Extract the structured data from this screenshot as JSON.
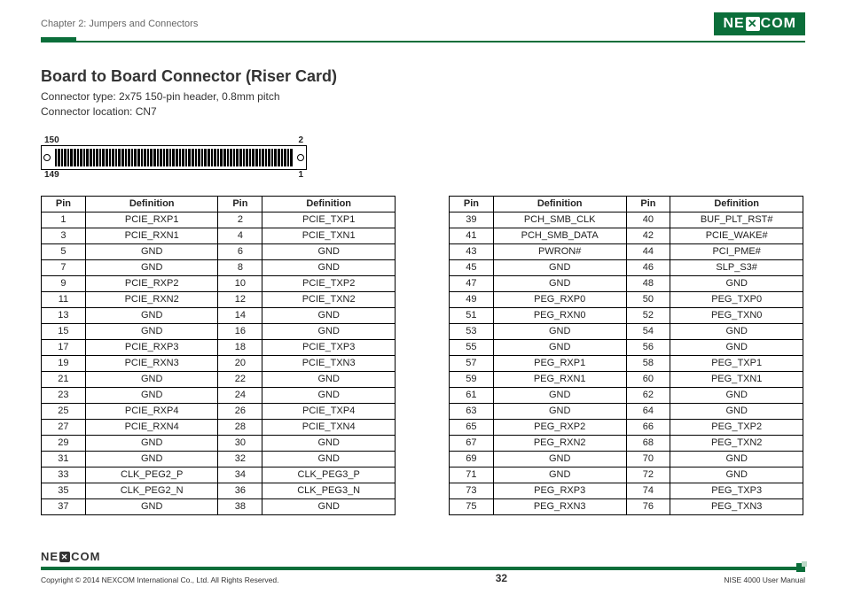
{
  "header": {
    "chapter": "Chapter 2: Jumpers and Connectors",
    "brand": "NEXCOM"
  },
  "section": {
    "title": "Board to Board Connector (Riser Card)",
    "connector_type": "Connector type: 2x75 150-pin header, 0.8mm pitch",
    "connector_location": "Connector location: CN7"
  },
  "diagram_labels": {
    "top_left": "150",
    "top_right": "2",
    "bot_left": "149",
    "bot_right": "1"
  },
  "table_headers": {
    "pin": "Pin",
    "definition": "Definition"
  },
  "table_left": [
    {
      "p1": "1",
      "d1": "PCIE_RXP1",
      "p2": "2",
      "d2": "PCIE_TXP1"
    },
    {
      "p1": "3",
      "d1": "PCIE_RXN1",
      "p2": "4",
      "d2": "PCIE_TXN1"
    },
    {
      "p1": "5",
      "d1": "GND",
      "p2": "6",
      "d2": "GND"
    },
    {
      "p1": "7",
      "d1": "GND",
      "p2": "8",
      "d2": "GND"
    },
    {
      "p1": "9",
      "d1": "PCIE_RXP2",
      "p2": "10",
      "d2": "PCIE_TXP2"
    },
    {
      "p1": "11",
      "d1": "PCIE_RXN2",
      "p2": "12",
      "d2": "PCIE_TXN2"
    },
    {
      "p1": "13",
      "d1": "GND",
      "p2": "14",
      "d2": "GND"
    },
    {
      "p1": "15",
      "d1": "GND",
      "p2": "16",
      "d2": "GND"
    },
    {
      "p1": "17",
      "d1": "PCIE_RXP3",
      "p2": "18",
      "d2": "PCIE_TXP3"
    },
    {
      "p1": "19",
      "d1": "PCIE_RXN3",
      "p2": "20",
      "d2": "PCIE_TXN3"
    },
    {
      "p1": "21",
      "d1": "GND",
      "p2": "22",
      "d2": "GND"
    },
    {
      "p1": "23",
      "d1": "GND",
      "p2": "24",
      "d2": "GND"
    },
    {
      "p1": "25",
      "d1": "PCIE_RXP4",
      "p2": "26",
      "d2": "PCIE_TXP4"
    },
    {
      "p1": "27",
      "d1": "PCIE_RXN4",
      "p2": "28",
      "d2": "PCIE_TXN4"
    },
    {
      "p1": "29",
      "d1": "GND",
      "p2": "30",
      "d2": "GND"
    },
    {
      "p1": "31",
      "d1": "GND",
      "p2": "32",
      "d2": "GND"
    },
    {
      "p1": "33",
      "d1": "CLK_PEG2_P",
      "p2": "34",
      "d2": "CLK_PEG3_P"
    },
    {
      "p1": "35",
      "d1": "CLK_PEG2_N",
      "p2": "36",
      "d2": "CLK_PEG3_N"
    },
    {
      "p1": "37",
      "d1": "GND",
      "p2": "38",
      "d2": "GND"
    }
  ],
  "table_right": [
    {
      "p1": "39",
      "d1": "PCH_SMB_CLK",
      "p2": "40",
      "d2": "BUF_PLT_RST#"
    },
    {
      "p1": "41",
      "d1": "PCH_SMB_DATA",
      "p2": "42",
      "d2": "PCIE_WAKE#"
    },
    {
      "p1": "43",
      "d1": "PWRON#",
      "p2": "44",
      "d2": "PCI_PME#"
    },
    {
      "p1": "45",
      "d1": "GND",
      "p2": "46",
      "d2": "SLP_S3#"
    },
    {
      "p1": "47",
      "d1": "GND",
      "p2": "48",
      "d2": "GND"
    },
    {
      "p1": "49",
      "d1": "PEG_RXP0",
      "p2": "50",
      "d2": "PEG_TXP0"
    },
    {
      "p1": "51",
      "d1": "PEG_RXN0",
      "p2": "52",
      "d2": "PEG_TXN0"
    },
    {
      "p1": "53",
      "d1": "GND",
      "p2": "54",
      "d2": "GND"
    },
    {
      "p1": "55",
      "d1": "GND",
      "p2": "56",
      "d2": "GND"
    },
    {
      "p1": "57",
      "d1": "PEG_RXP1",
      "p2": "58",
      "d2": "PEG_TXP1"
    },
    {
      "p1": "59",
      "d1": "PEG_RXN1",
      "p2": "60",
      "d2": "PEG_TXN1"
    },
    {
      "p1": "61",
      "d1": "GND",
      "p2": "62",
      "d2": "GND"
    },
    {
      "p1": "63",
      "d1": "GND",
      "p2": "64",
      "d2": "GND"
    },
    {
      "p1": "65",
      "d1": "PEG_RXP2",
      "p2": "66",
      "d2": "PEG_TXP2"
    },
    {
      "p1": "67",
      "d1": "PEG_RXN2",
      "p2": "68",
      "d2": "PEG_TXN2"
    },
    {
      "p1": "69",
      "d1": "GND",
      "p2": "70",
      "d2": "GND"
    },
    {
      "p1": "71",
      "d1": "GND",
      "p2": "72",
      "d2": "GND"
    },
    {
      "p1": "73",
      "d1": "PEG_RXP3",
      "p2": "74",
      "d2": "PEG_TXP3"
    },
    {
      "p1": "75",
      "d1": "PEG_RXN3",
      "p2": "76",
      "d2": "PEG_TXN3"
    }
  ],
  "footer": {
    "brand": "NEXCOM",
    "copyright": "Copyright © 2014 NEXCOM International Co., Ltd. All Rights Reserved.",
    "page": "32",
    "manual": "NISE 4000 User Manual"
  }
}
